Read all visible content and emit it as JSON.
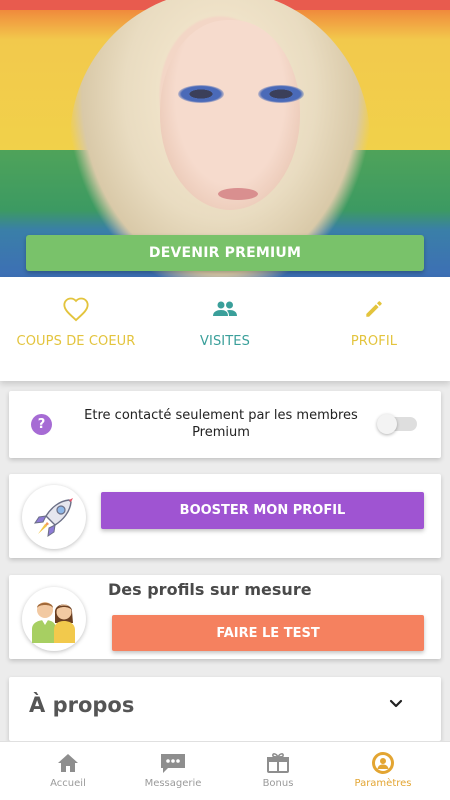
{
  "hero": {
    "premium_button": "DEVENIR PREMIUM"
  },
  "tabs": [
    {
      "label": "COUPS DE COEUR",
      "icon": "heart-outline-icon",
      "color": "#e3c43d"
    },
    {
      "label": "VISITES",
      "icon": "people-icon",
      "color": "#3a9f9a"
    },
    {
      "label": "PROFIL",
      "icon": "pencil-icon",
      "color": "#e3c43d"
    }
  ],
  "contact_setting": {
    "text": "Etre contacté seulement par les membres Premium",
    "icon": "question-icon",
    "toggle_on": false
  },
  "boost": {
    "button": "BOOSTER MON PROFIL",
    "icon": "rocket-icon",
    "color": "#9f54d2"
  },
  "custom_profiles": {
    "title": "Des profils sur mesure",
    "button": "FAIRE LE TEST",
    "icon": "couple-icon",
    "color": "#f5815f"
  },
  "about": {
    "title": "À propos",
    "icon": "chevron-down-icon"
  },
  "nav": [
    {
      "label": "Accueil",
      "icon": "home-icon",
      "active": false
    },
    {
      "label": "Messagerie",
      "icon": "chat-icon",
      "active": false
    },
    {
      "label": "Bonus",
      "icon": "gift-icon",
      "active": false
    },
    {
      "label": "Paramètres",
      "icon": "settings-icon",
      "active": true
    }
  ],
  "colors": {
    "premium": "#79c26a",
    "accent_active": "#e3a532"
  }
}
